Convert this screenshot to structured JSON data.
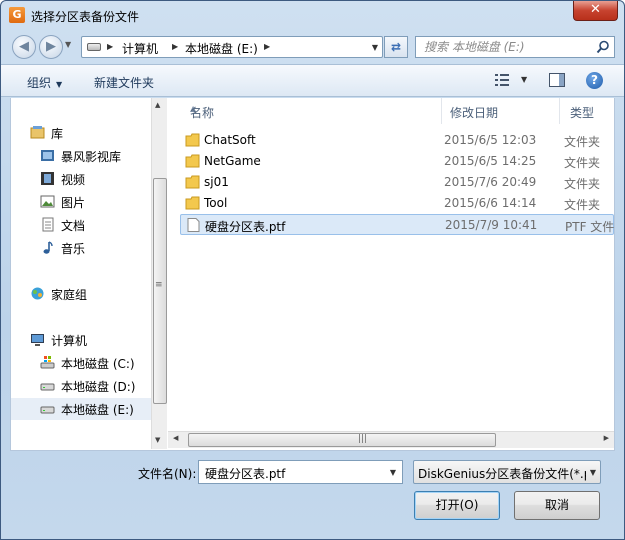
{
  "window": {
    "title": "选择分区表备份文件",
    "close_label": "✕"
  },
  "address": {
    "segments": [
      "计算机",
      "本地磁盘 (E:)"
    ],
    "search_placeholder": "搜索 本地磁盘 (E:)"
  },
  "toolbar": {
    "organize_label": "组织",
    "new_folder_label": "新建文件夹",
    "help_label": "?"
  },
  "sidebar": {
    "items": [
      {
        "label": "库",
        "icon": "library-icon"
      },
      {
        "label": "暴风影视库",
        "icon": "video-library-icon"
      },
      {
        "label": "视频",
        "icon": "video-icon"
      },
      {
        "label": "图片",
        "icon": "picture-icon"
      },
      {
        "label": "文档",
        "icon": "document-icon"
      },
      {
        "label": "音乐",
        "icon": "music-icon"
      },
      {
        "label": "家庭组",
        "icon": "homegroup-icon"
      },
      {
        "label": "计算机",
        "icon": "computer-icon"
      },
      {
        "label": "本地磁盘 (C:)",
        "icon": "drive-c-icon"
      },
      {
        "label": "本地磁盘 (D:)",
        "icon": "drive-icon"
      },
      {
        "label": "本地磁盘 (E:)",
        "icon": "drive-icon"
      }
    ]
  },
  "files": {
    "columns": [
      "名称",
      "修改日期",
      "类型"
    ],
    "rows": [
      {
        "name": "ChatSoft",
        "date": "2015/6/5 12:03",
        "type": "文件夹",
        "icon": "folder-icon"
      },
      {
        "name": "NetGame",
        "date": "2015/6/5 14:25",
        "type": "文件夹",
        "icon": "folder-icon"
      },
      {
        "name": "sj01",
        "date": "2015/7/6 20:49",
        "type": "文件夹",
        "icon": "folder-icon"
      },
      {
        "name": "Tool",
        "date": "2015/6/6 14:14",
        "type": "文件夹",
        "icon": "folder-icon"
      },
      {
        "name": "硬盘分区表.ptf",
        "date": "2015/7/9 10:41",
        "type": "PTF 文件",
        "icon": "file-icon"
      }
    ]
  },
  "bottom": {
    "filename_label": "文件名(N):",
    "filename_value": "硬盘分区表.ptf",
    "filetype_value": "DiskGenius分区表备份文件(*.ptf)",
    "open_label": "打开(O)",
    "cancel_label": "取消"
  }
}
